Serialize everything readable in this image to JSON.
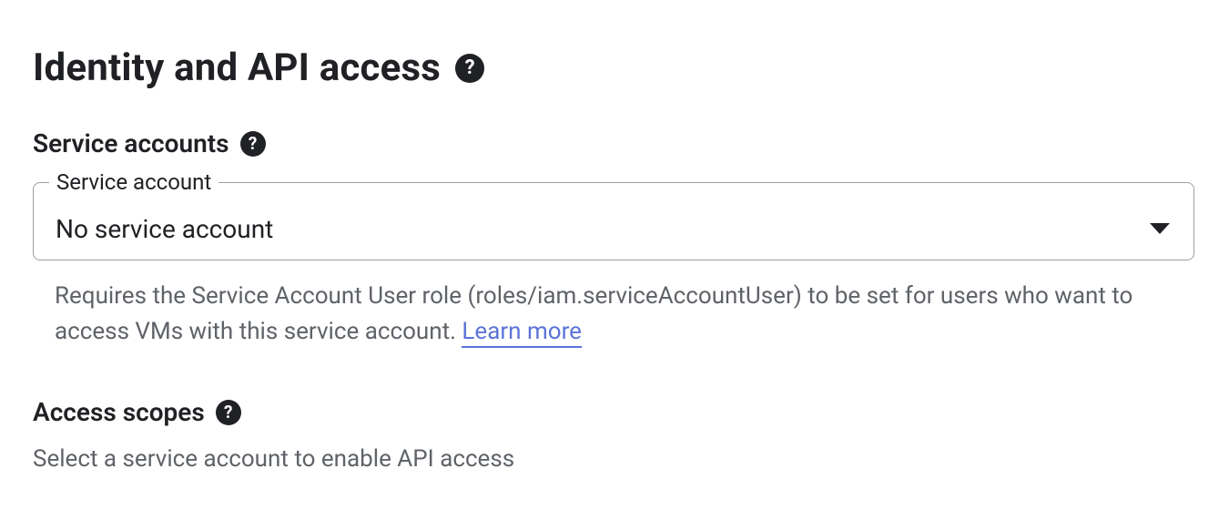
{
  "section": {
    "title": "Identity and API access"
  },
  "serviceAccounts": {
    "heading": "Service accounts",
    "field": {
      "label": "Service account",
      "selected": "No service account"
    },
    "helper": {
      "text": "Requires the Service Account User role (roles/iam.serviceAccountUser) to be set for users who want to access VMs with this service account. ",
      "link_text": "Learn more"
    }
  },
  "accessScopes": {
    "heading": "Access scopes",
    "hint": "Select a service account to enable API access"
  },
  "glyphs": {
    "help": "?"
  }
}
